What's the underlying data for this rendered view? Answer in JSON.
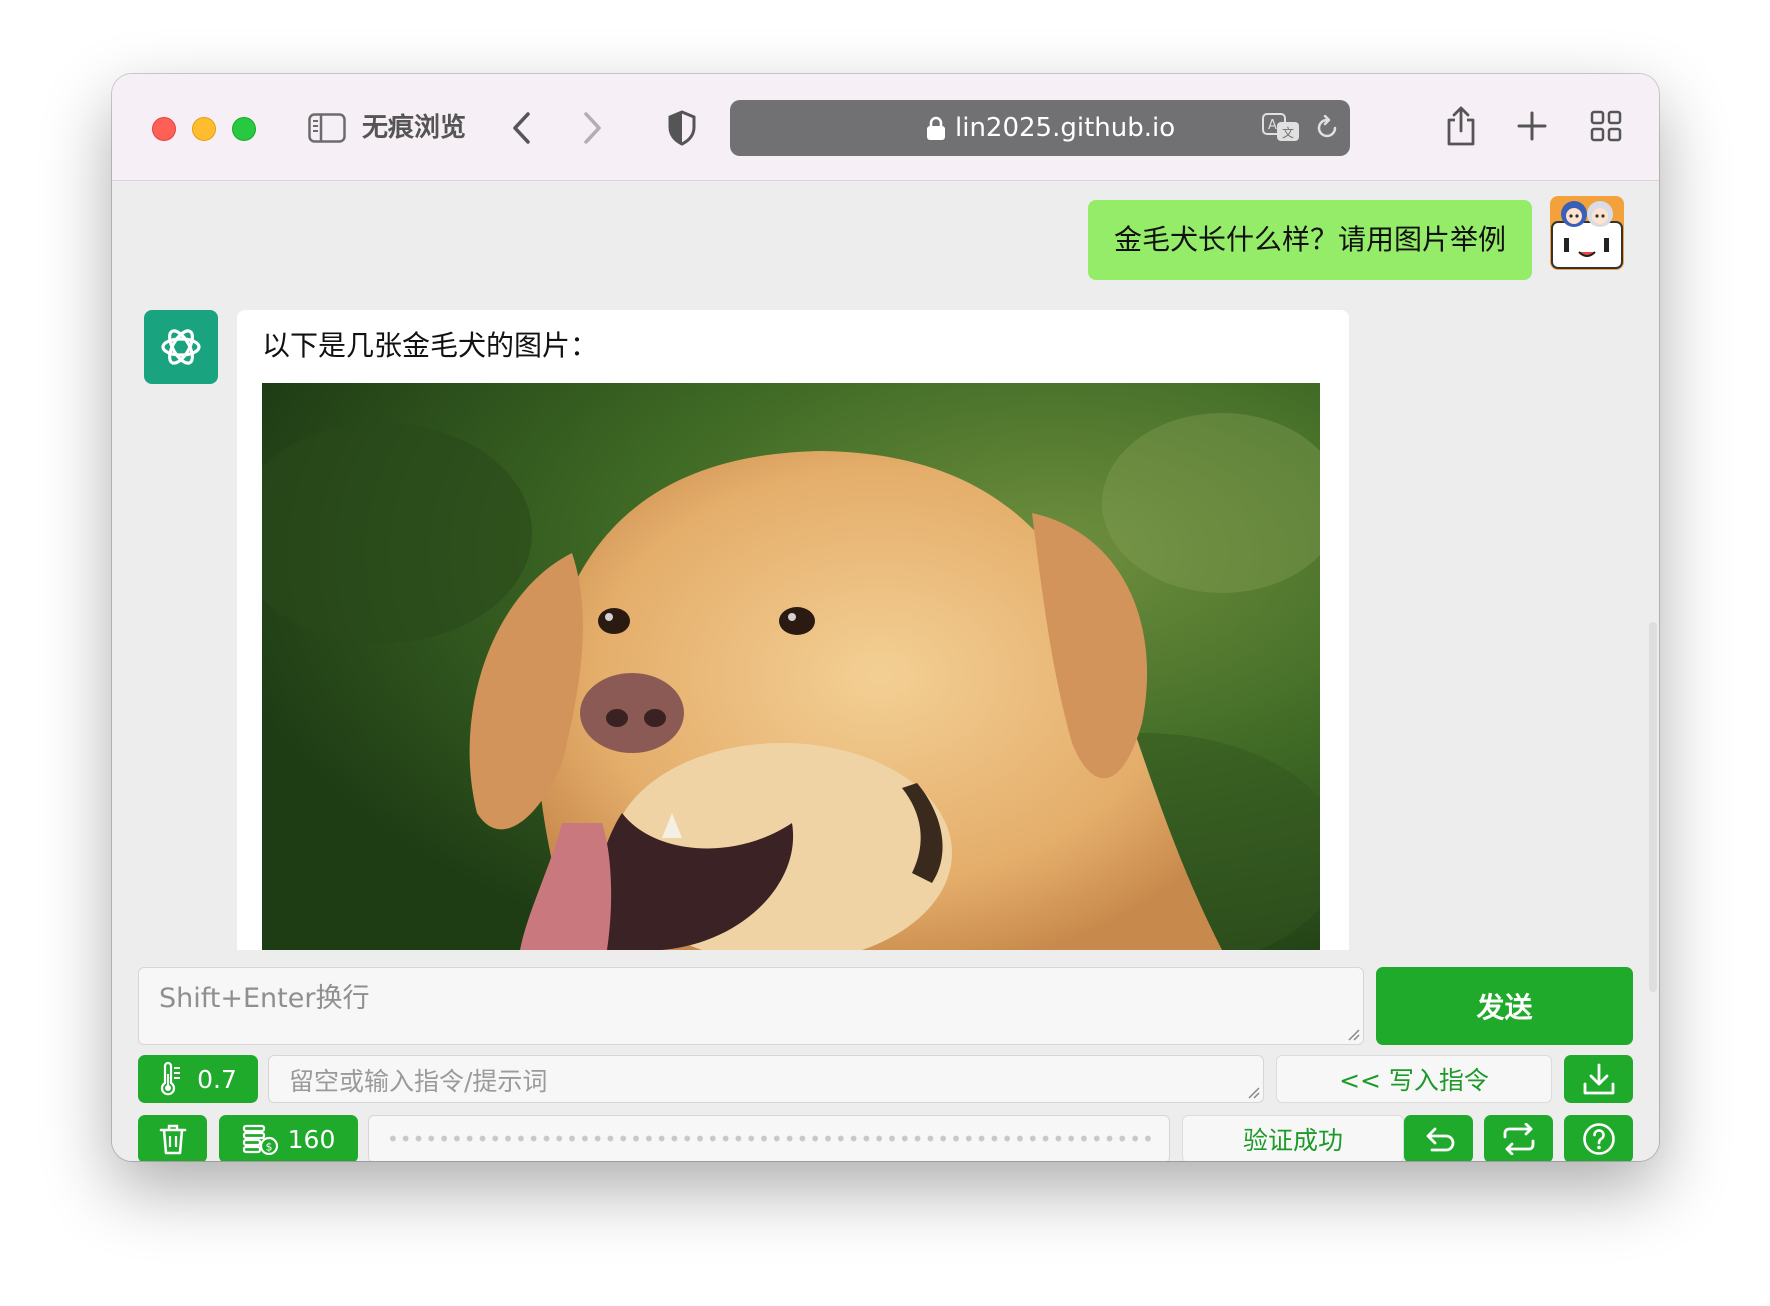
{
  "browser": {
    "private_label": "无痕浏览",
    "url": "lin2025.github.io"
  },
  "chat": {
    "user_message": "金毛犬长什么样？请用图片举例",
    "assistant_message": "以下是几张金毛犬的图片："
  },
  "controls": {
    "input_placeholder": "Shift+Enter换行",
    "send_label": "发送",
    "temperature": "0.7",
    "system_placeholder": "留空或输入指令/提示词",
    "write_label": "<< 写入指令",
    "tokens": "160",
    "key_masked": "••••••••••••••••••••••••••••••••••••••••••••••••••••••••••••••••••",
    "verify_label": "验证成功"
  },
  "colors": {
    "accent": "#1faa2b",
    "user_bubble": "#95ec69",
    "bot_avatar": "#19a37f"
  },
  "icons": {
    "toolbar": [
      "sidebar-icon",
      "back-icon",
      "forward-icon",
      "shield-icon",
      "lock-icon",
      "translate-icon",
      "reload-icon",
      "share-icon",
      "plus-icon",
      "tabs-icon"
    ],
    "controls": [
      "thermometer-icon",
      "download-icon",
      "trash-icon",
      "coins-icon",
      "undo-icon",
      "swap-icon",
      "help-icon"
    ]
  }
}
